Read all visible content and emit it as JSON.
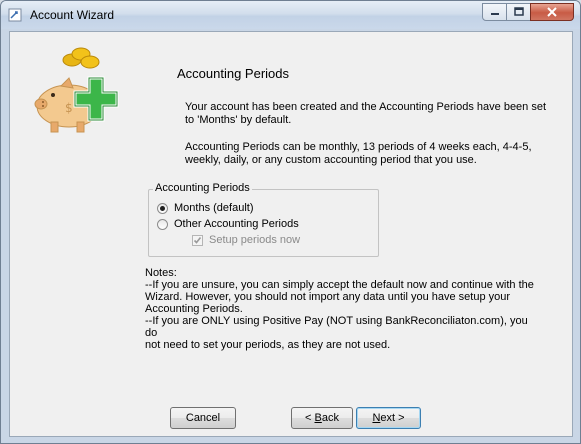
{
  "window": {
    "title": "Account Wizard"
  },
  "heading": "Accounting Periods",
  "intro": {
    "line1": "Your account has been created and the Accounting Periods have been set",
    "line2": "to 'Months' by default.",
    "line3": "Accounting Periods can be monthly, 13 periods of 4 weeks each, 4-4-5,",
    "line4": "weekly, daily, or any custom accounting period that you use."
  },
  "group": {
    "legend": "Accounting Periods",
    "options": [
      {
        "label": "Months (default)",
        "selected": true
      },
      {
        "label": "Other Accounting Periods",
        "selected": false
      }
    ],
    "setup_checkbox": {
      "label": "Setup periods now",
      "checked": true,
      "disabled": true
    }
  },
  "notes": {
    "title": "Notes:",
    "lines": [
      "--If you are unsure, you can simply accept the default now and continue with the",
      "Wizard.  However, you should not import any data until you have setup your",
      "Accounting Periods.",
      "--If you are ONLY using Positive Pay (NOT using BankReconciliaton.com), you do",
      "not need to set your periods, as they are not used."
    ]
  },
  "buttons": {
    "cancel": "Cancel",
    "back_prefix": "< ",
    "back_mnemonic": "B",
    "back_rest": "ack",
    "next_mnemonic": "N",
    "next_rest": "ext >"
  },
  "icons": {
    "app_icon": "wizard-window-icon",
    "piggy": "piggy-bank-add-icon"
  },
  "colors": {
    "accent_green": "#3cb649",
    "coin_gold": "#f2c21a",
    "piggy": "#f3c98f"
  }
}
